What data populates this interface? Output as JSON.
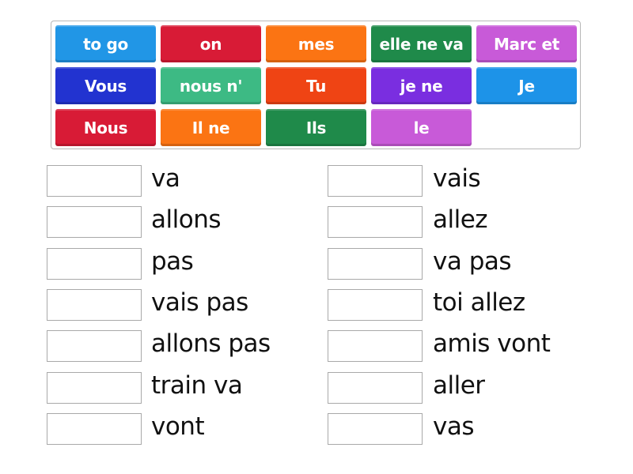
{
  "activity": "Match up — aller",
  "tiles": [
    {
      "label": "to go",
      "color": "#2196e6"
    },
    {
      "label": "on",
      "color": "#d81b36"
    },
    {
      "label": "mes",
      "color": "#fb7413"
    },
    {
      "label": "elle ne va",
      "color": "#1f8a4a"
    },
    {
      "label": "Marc et",
      "color": "#c85ad8"
    },
    {
      "label": "Vous",
      "color": "#2233d0"
    },
    {
      "label": "nous n'",
      "color": "#3dba84"
    },
    {
      "label": "Tu",
      "color": "#ef4414"
    },
    {
      "label": "je ne",
      "color": "#7a2ee0"
    },
    {
      "label": "Je",
      "color": "#1d93e8"
    },
    {
      "label": "Nous",
      "color": "#d81b36"
    },
    {
      "label": "Il ne",
      "color": "#fb7413"
    },
    {
      "label": "Ils",
      "color": "#1f8a4a"
    },
    {
      "label": "le",
      "color": "#c85ad8"
    }
  ],
  "left_items": [
    {
      "text": "va",
      "answer": ""
    },
    {
      "text": "allons",
      "answer": ""
    },
    {
      "text": "pas",
      "answer": ""
    },
    {
      "text": "vais pas",
      "answer": ""
    },
    {
      "text": "allons pas",
      "answer": ""
    },
    {
      "text": "train va",
      "answer": ""
    },
    {
      "text": "vont",
      "answer": ""
    }
  ],
  "right_items": [
    {
      "text": "vais",
      "answer": ""
    },
    {
      "text": "allez",
      "answer": ""
    },
    {
      "text": "va pas",
      "answer": ""
    },
    {
      "text": "toi allez",
      "answer": ""
    },
    {
      "text": "amis vont",
      "answer": ""
    },
    {
      "text": "aller",
      "answer": ""
    },
    {
      "text": "vas",
      "answer": ""
    }
  ]
}
